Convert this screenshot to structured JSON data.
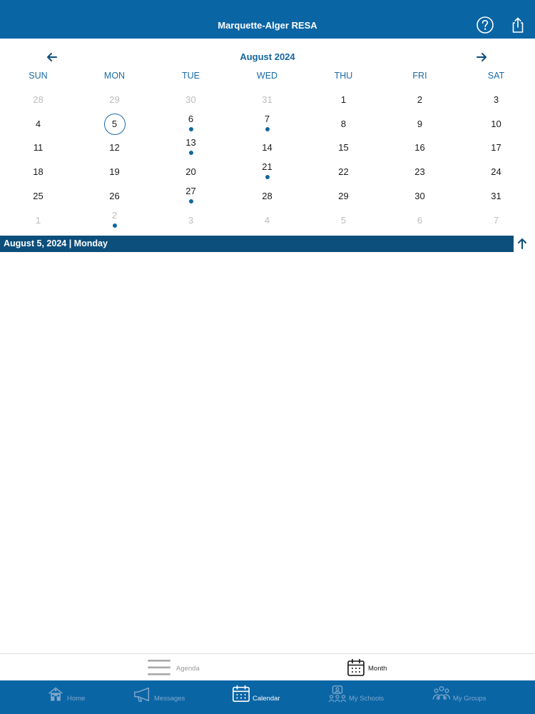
{
  "header": {
    "title": "Marquette-Alger RESA"
  },
  "calendar": {
    "month_label": "August 2024",
    "weekdays": [
      "SUN",
      "MON",
      "TUE",
      "WED",
      "THU",
      "FRI",
      "SAT"
    ],
    "weeks": [
      [
        {
          "d": "28",
          "o": true
        },
        {
          "d": "29",
          "o": true
        },
        {
          "d": "30",
          "o": true
        },
        {
          "d": "31",
          "o": true
        },
        {
          "d": "1"
        },
        {
          "d": "2"
        },
        {
          "d": "3"
        }
      ],
      [
        {
          "d": "4"
        },
        {
          "d": "5",
          "sel": true
        },
        {
          "d": "6",
          "ev": true
        },
        {
          "d": "7",
          "ev": true
        },
        {
          "d": "8"
        },
        {
          "d": "9"
        },
        {
          "d": "10"
        }
      ],
      [
        {
          "d": "11"
        },
        {
          "d": "12"
        },
        {
          "d": "13",
          "ev": true
        },
        {
          "d": "14"
        },
        {
          "d": "15"
        },
        {
          "d": "16"
        },
        {
          "d": "17"
        }
      ],
      [
        {
          "d": "18"
        },
        {
          "d": "19"
        },
        {
          "d": "20"
        },
        {
          "d": "21",
          "ev": true
        },
        {
          "d": "22"
        },
        {
          "d": "23"
        },
        {
          "d": "24"
        }
      ],
      [
        {
          "d": "25"
        },
        {
          "d": "26"
        },
        {
          "d": "27",
          "ev": true
        },
        {
          "d": "28"
        },
        {
          "d": "29"
        },
        {
          "d": "30"
        },
        {
          "d": "31"
        }
      ],
      [
        {
          "d": "1",
          "o": true
        },
        {
          "d": "2",
          "o": true,
          "ev": true
        },
        {
          "d": "3",
          "o": true
        },
        {
          "d": "4",
          "o": true
        },
        {
          "d": "5",
          "o": true
        },
        {
          "d": "6",
          "o": true
        },
        {
          "d": "7",
          "o": true
        }
      ]
    ],
    "selected_date_label": "August 5, 2024 | Monday"
  },
  "view_switch": {
    "agenda_label": "Agenda",
    "month_label": "Month",
    "active": "Month"
  },
  "tabs": [
    {
      "label": "Home",
      "icon": "home-icon",
      "active": false
    },
    {
      "label": "Messages",
      "icon": "megaphone-icon",
      "active": false
    },
    {
      "label": "Calendar",
      "icon": "calendar-icon",
      "active": true
    },
    {
      "label": "My Schools",
      "icon": "schools-icon",
      "active": false
    },
    {
      "label": "My Groups",
      "icon": "groups-icon",
      "active": false
    }
  ],
  "colors": {
    "brand": "#0a65a5",
    "date_bar": "#0c4f7c",
    "event_dot": "#11679f"
  }
}
